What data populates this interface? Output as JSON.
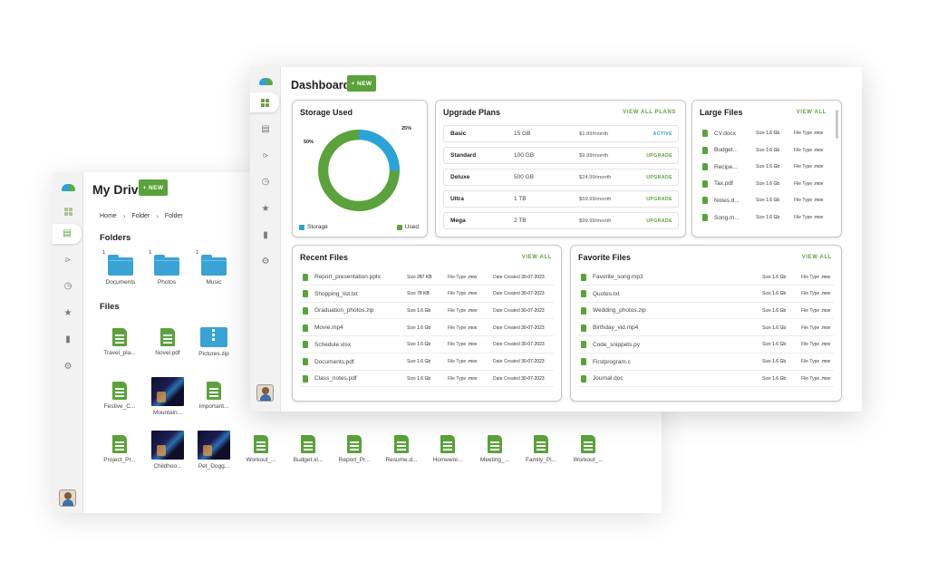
{
  "drive": {
    "title": "My Drive",
    "new_label": "+ NEW",
    "breadcrumb": [
      "Home",
      "Folder",
      "Folder"
    ],
    "folders_heading": "Folders",
    "files_heading": "Files",
    "folders": [
      {
        "count": "1",
        "name": "Documents"
      },
      {
        "count": "1",
        "name": "Photos"
      },
      {
        "count": "1",
        "name": "Music"
      }
    ],
    "files_row1": [
      {
        "name": "Travel_pla...",
        "kind": "doc"
      },
      {
        "name": "Novel.pdf",
        "kind": "doc"
      },
      {
        "name": "Pictures.zip",
        "kind": "zip"
      }
    ],
    "files_row2": [
      {
        "name": "Festive_C...",
        "kind": "doc"
      },
      {
        "name": "Mountain...",
        "kind": "image"
      },
      {
        "name": "Important...",
        "kind": "doc"
      }
    ],
    "files_row3": [
      {
        "name": "Project_Pr...",
        "kind": "doc"
      },
      {
        "name": "Childhoo...",
        "kind": "image"
      },
      {
        "name": "Pet_Dogg...",
        "kind": "image"
      },
      {
        "name": "Workout_...",
        "kind": "doc"
      },
      {
        "name": "Budget.xl...",
        "kind": "doc"
      },
      {
        "name": "Report_Pr...",
        "kind": "doc"
      },
      {
        "name": "Resume.d...",
        "kind": "doc"
      },
      {
        "name": "Homewor...",
        "kind": "doc"
      },
      {
        "name": "Meeting_...",
        "kind": "doc"
      },
      {
        "name": "Family_Pi...",
        "kind": "doc"
      },
      {
        "name": "Workout_...",
        "kind": "doc"
      }
    ]
  },
  "dashboard": {
    "title": "Dashboard",
    "new_label": "+ NEW",
    "storage": {
      "title": "Storage Used",
      "storage_pct": 25,
      "used_pct": 50,
      "label_storage_pct": "25%",
      "label_used_pct": "50%",
      "legend_storage": "Storage",
      "legend_used": "Used",
      "color_storage": "#2aa3d8",
      "color_used": "#5aa23b"
    },
    "plans": {
      "title": "Upgrade Plans",
      "view_all": "VIEW ALL PLANS",
      "rows": [
        {
          "name": "Basic",
          "size": "15 GB",
          "price": "$1.99/month",
          "action": "ACTIVE"
        },
        {
          "name": "Standard",
          "size": "100 GB",
          "price": "$9.99/month",
          "action": "UPGRADE"
        },
        {
          "name": "Deluxe",
          "size": "500 GB",
          "price": "$24.99/month",
          "action": "UPGRADE"
        },
        {
          "name": "Ultra",
          "size": "1 TB",
          "price": "$59.99/month",
          "action": "UPGRADE"
        },
        {
          "name": "Mega",
          "size": "2 TB",
          "price": "$99.99/month",
          "action": "UPGRADE"
        }
      ]
    },
    "large": {
      "title": "Large Files",
      "view_all": "VIEW ALL",
      "size_label": "Size",
      "type_label": "File Type",
      "rows": [
        {
          "name": "CV.docx",
          "size": "1.6 Gb",
          "type": ".mov"
        },
        {
          "name": "Budget...",
          "size": "1.6 Gb",
          "type": ".mov"
        },
        {
          "name": "Recipe...",
          "size": "1.6 Gb",
          "type": ".mov"
        },
        {
          "name": "Tax.pdf",
          "size": "1.6 Gb",
          "type": ".mov"
        },
        {
          "name": "Notes.d...",
          "size": "1.6 Gb",
          "type": ".mov"
        },
        {
          "name": "Song.m...",
          "size": "1.6 Gb",
          "type": ".mov"
        }
      ]
    },
    "recent": {
      "title": "Recent Files",
      "view_all": "VIEW ALL",
      "size_label": "Size",
      "type_label": "File Type",
      "date_label": "Date Created",
      "rows": [
        {
          "name": "Report_presentation.pptx",
          "size": "287 KB",
          "type": ".mov",
          "date": "30-07-2023"
        },
        {
          "name": "Shopping_list.txt",
          "size": "78   KB",
          "type": ".mov",
          "date": "30-07-2023"
        },
        {
          "name": "Graduation_photos.zip",
          "size": "1.6 Gb",
          "type": ".mov",
          "date": "30-07-2023"
        },
        {
          "name": "Movie.mp4",
          "size": "1.6 Gb",
          "type": ".mov",
          "date": "30-07-2023"
        },
        {
          "name": "Schedule.xlsx",
          "size": "1.6 Gb",
          "type": ".mov",
          "date": "30-07-2023"
        },
        {
          "name": "Documents.pdf",
          "size": "1.6 Gb",
          "type": ".mov",
          "date": "30-07-2023"
        },
        {
          "name": "Class_notes.pdf",
          "size": "1.6 Gb",
          "type": ".mov",
          "date": "30-07-2023"
        }
      ]
    },
    "favorite": {
      "title": "Favorite Files",
      "view_all": "VIEW ALL",
      "size_label": "Size",
      "type_label": "File Type",
      "rows": [
        {
          "name": "Favorite_song.mp3",
          "size": "1.6 Gb",
          "type": ".mov"
        },
        {
          "name": "Quotes.txt",
          "size": "1.6 Gb",
          "type": ".mov"
        },
        {
          "name": "Wedding_photos.zip",
          "size": "1.6 Gb",
          "type": ".mov"
        },
        {
          "name": "Birthday_vid.mp4",
          "size": "1.6 Gb",
          "type": ".mov"
        },
        {
          "name": "Code_snippets.py",
          "size": "1.6 Gb",
          "type": ".mov"
        },
        {
          "name": "Firstprogram.c",
          "size": "1.6 Gb",
          "type": ".mov"
        },
        {
          "name": "Journal.doc",
          "size": "1.6 Gb",
          "type": ".mov"
        }
      ]
    }
  },
  "rail_icons": [
    "logo-icon",
    "dashboard-icon",
    "drive-icon",
    "share-icon",
    "history-icon",
    "star-icon",
    "trash-icon",
    "gear-icon"
  ]
}
